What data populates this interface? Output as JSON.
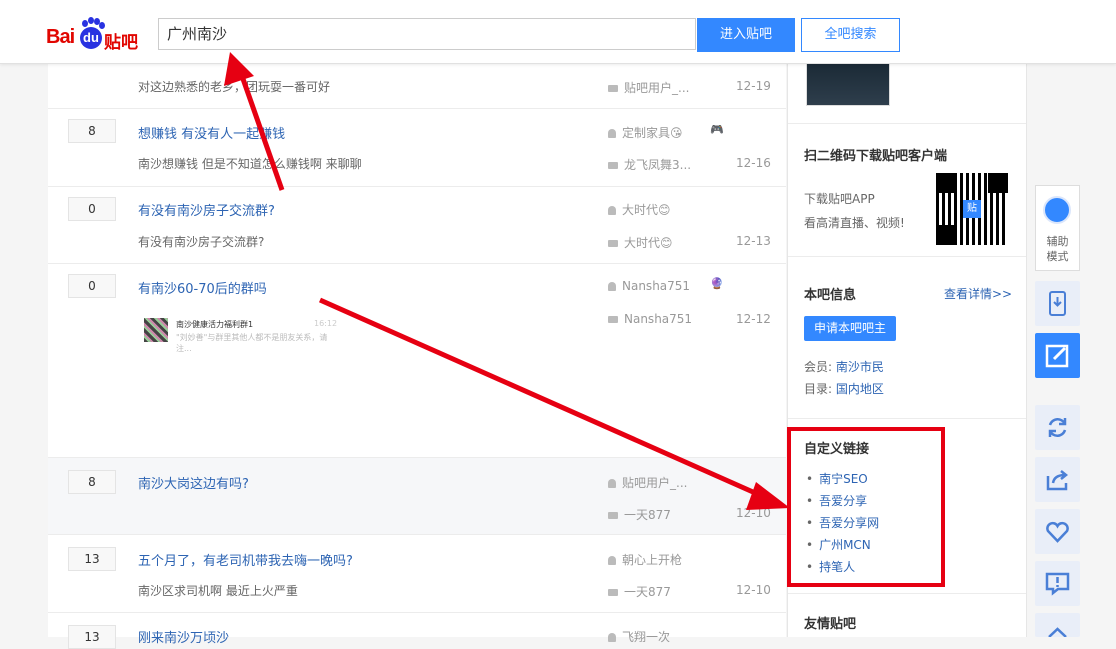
{
  "header": {
    "logo_bai": "Bai",
    "logo_du": "du",
    "logo_tieba": "贴吧",
    "search_value": "广州南沙",
    "enter_button": "进入贴吧",
    "all_search_button": "全吧搜索"
  },
  "threads": [
    {
      "reply": "",
      "title": "",
      "desc": "对这边熟悉的老乡，团玩耍一番可好",
      "author": "",
      "replier": "贴吧用户_...",
      "date": "12-19"
    },
    {
      "reply": "8",
      "title": "想赚钱 有没有人一起赚钱",
      "desc": "南沙想赚钱 但是不知道怎么赚钱啊 来聊聊",
      "author": "定制家具😘",
      "replier": "龙飞凤舞3...",
      "date": "12-16",
      "badge": "🎮"
    },
    {
      "reply": "0",
      "title": "有没有南沙房子交流群?",
      "desc": "有没有南沙房子交流群?",
      "author": "大时代😊",
      "replier": "大时代😊",
      "date": "12-13"
    },
    {
      "reply": "0",
      "title": "有南沙60-70后的群吗",
      "desc": "",
      "author": "Nansha751",
      "replier": "Nansha751",
      "date": "12-12",
      "badge": "🔮",
      "thumb": {
        "title": "南沙健康活力福利群1",
        "sub": "\"刘妙善\"与群里其他人都不是朋友关系，请注...",
        "time": "16:12"
      }
    },
    {
      "reply": "8",
      "title": "南沙大岗这边有吗?",
      "desc": "",
      "author": "贴吧用户_...",
      "replier": "一天877",
      "date": "12-10"
    },
    {
      "reply": "13",
      "title": "五个月了，有老司机带我去嗨一晚吗?",
      "desc": "南沙区求司机啊 最近上火严重",
      "author": "朝心上开枪",
      "replier": "一天877",
      "date": "12-10"
    },
    {
      "reply": "13",
      "title": "刚来南沙万顷沙",
      "desc": "",
      "author": "飞翔一次",
      "replier": "",
      "date": ""
    }
  ],
  "sidebar": {
    "qr_title": "扫二维码下载贴吧客户端",
    "qr_line1": "下载贴吧APP",
    "qr_line2": "看高清直播、视频!",
    "qr_center": "贴",
    "info_title": "本吧信息",
    "info_more": "查看详情>>",
    "apply_button": "申请本吧吧主",
    "member_label": "会员:",
    "member_value": "南沙市民",
    "dir_label": "目录:",
    "dir_value": "国内地区",
    "custom_title": "自定义链接",
    "custom_links": [
      "南宁SEO",
      "吾爱分享",
      "吾爱分享网",
      "广州MCN",
      "持笔人"
    ],
    "friends_title": "友情贴吧"
  },
  "toolbar": {
    "assist_label_1": "辅助",
    "assist_label_2": "模式"
  },
  "colors": {
    "accent": "#3388ff",
    "link": "#2d64b3",
    "annotation": "#e60012"
  }
}
